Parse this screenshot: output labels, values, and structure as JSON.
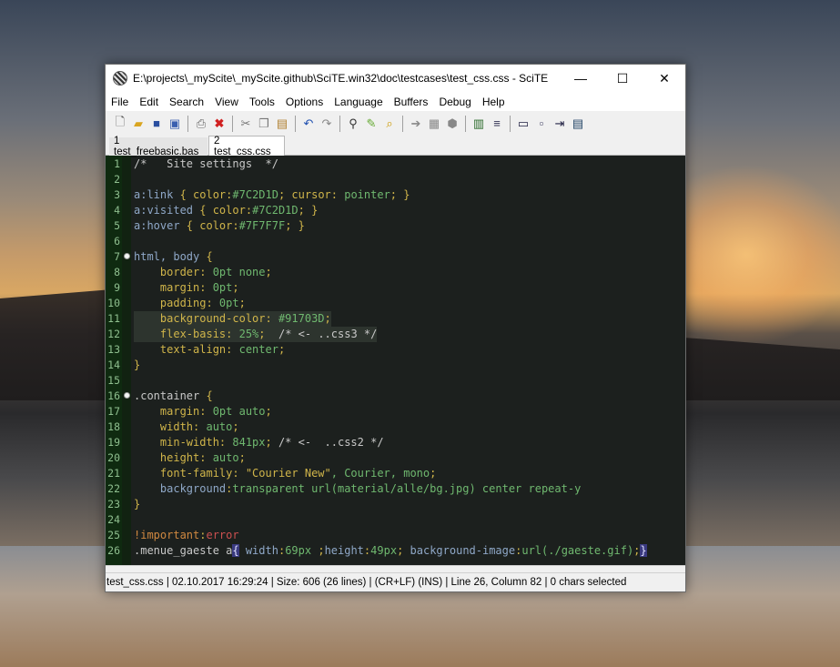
{
  "window": {
    "title": "E:\\projects\\_myScite\\_myScite.github\\SciTE.win32\\doc\\testcases\\test_css.css - SciTE",
    "minimize": "—",
    "maximize": "☐",
    "close": "✕"
  },
  "menu": [
    "File",
    "Edit",
    "Search",
    "View",
    "Tools",
    "Options",
    "Language",
    "Buffers",
    "Debug",
    "Help"
  ],
  "toolbar_icons": [
    "new-icon",
    "open-icon",
    "save-icon",
    "save-all-icon",
    "print-icon",
    "close-file-icon",
    "cut-icon",
    "copy-icon",
    "paste-icon",
    "undo-icon",
    "redo-icon",
    "find-icon",
    "replace-icon",
    "find-in-files-icon",
    "compile-icon",
    "build-icon",
    "go-icon",
    "abbrev-icon",
    "wrap-icon",
    "toggle-output-icon",
    "macro-icon",
    "fold-icon",
    "options-icon"
  ],
  "tabs": [
    {
      "label": "1 test_freebasic.bas"
    },
    {
      "label": "2 test_css.css"
    }
  ],
  "code_lines": [
    {
      "n": "1",
      "segments": [
        [
          "c-com",
          "/*   Site settings  */"
        ]
      ]
    },
    {
      "n": "2",
      "segments": []
    },
    {
      "n": "3",
      "segments": [
        [
          "c-sel",
          "a:link "
        ],
        [
          "c-brace",
          "{ "
        ],
        [
          "c-prop",
          "color:"
        ],
        [
          "c-hashval",
          "#7C2D1D"
        ],
        [
          "c-brace",
          "; "
        ],
        [
          "c-prop",
          "cursor: "
        ],
        [
          "c-val",
          "pointer"
        ],
        [
          "c-brace",
          "; }"
        ]
      ]
    },
    {
      "n": "4",
      "segments": [
        [
          "c-sel",
          "a:visited "
        ],
        [
          "c-brace",
          "{ "
        ],
        [
          "c-prop",
          "color:"
        ],
        [
          "c-hashval",
          "#7C2D1D"
        ],
        [
          "c-brace",
          "; }"
        ]
      ]
    },
    {
      "n": "5",
      "segments": [
        [
          "c-sel",
          "a:hover "
        ],
        [
          "c-brace",
          "{ "
        ],
        [
          "c-prop",
          "color:"
        ],
        [
          "c-hashval",
          "#7F7F7F"
        ],
        [
          "c-brace",
          "; }"
        ]
      ]
    },
    {
      "n": "6",
      "segments": []
    },
    {
      "n": "7",
      "fold": true,
      "segments": [
        [
          "c-sel",
          "html, body "
        ],
        [
          "c-brace",
          "{"
        ]
      ]
    },
    {
      "n": "8",
      "segments": [
        [
          "c-prop",
          "    border: "
        ],
        [
          "c-val",
          "0pt none"
        ],
        [
          "c-brace",
          ";"
        ]
      ]
    },
    {
      "n": "9",
      "segments": [
        [
          "c-prop",
          "    margin: "
        ],
        [
          "c-val",
          "0pt"
        ],
        [
          "c-brace",
          ";"
        ]
      ]
    },
    {
      "n": "10",
      "segments": [
        [
          "c-prop",
          "    padding: "
        ],
        [
          "c-val",
          "0pt"
        ],
        [
          "c-brace",
          ";"
        ]
      ]
    },
    {
      "n": "11",
      "hl": true,
      "segments": [
        [
          "c-prop",
          "    background-color: "
        ],
        [
          "c-val",
          "#91703D"
        ],
        [
          "c-brace",
          ";"
        ]
      ]
    },
    {
      "n": "12",
      "hl": true,
      "segments": [
        [
          "c-prop",
          "    flex-basis: "
        ],
        [
          "c-val",
          "25%"
        ],
        [
          "c-brace",
          ";  "
        ],
        [
          "c-com",
          "/* <- ..css3 */"
        ]
      ]
    },
    {
      "n": "13",
      "segments": [
        [
          "c-prop",
          "    text-align: "
        ],
        [
          "c-val",
          "center"
        ],
        [
          "c-brace",
          ";"
        ]
      ]
    },
    {
      "n": "14",
      "segments": [
        [
          "c-brace",
          "}"
        ]
      ]
    },
    {
      "n": "15",
      "segments": []
    },
    {
      "n": "16",
      "fold": true,
      "segments": [
        [
          "c-cls",
          ".container "
        ],
        [
          "c-brace",
          "{"
        ]
      ]
    },
    {
      "n": "17",
      "segments": [
        [
          "c-prop",
          "    margin: "
        ],
        [
          "c-val",
          "0pt auto"
        ],
        [
          "c-brace",
          ";"
        ]
      ]
    },
    {
      "n": "18",
      "segments": [
        [
          "c-prop",
          "    width: "
        ],
        [
          "c-val",
          "auto"
        ],
        [
          "c-brace",
          ";"
        ]
      ]
    },
    {
      "n": "19",
      "segments": [
        [
          "c-prop",
          "    min-width: "
        ],
        [
          "c-val",
          "841px"
        ],
        [
          "c-brace",
          "; "
        ],
        [
          "c-com",
          "/* <-  ..css2 */"
        ]
      ]
    },
    {
      "n": "20",
      "segments": [
        [
          "c-prop",
          "    height: "
        ],
        [
          "c-val",
          "auto"
        ],
        [
          "c-brace",
          ";"
        ]
      ]
    },
    {
      "n": "21",
      "segments": [
        [
          "c-prop",
          "    font-family: "
        ],
        [
          "c-str",
          "\"Courier New\""
        ],
        [
          "c-val",
          ", Courier, mono"
        ],
        [
          "c-brace",
          ";"
        ]
      ]
    },
    {
      "n": "22",
      "segments": [
        [
          "c-sel",
          "    background"
        ],
        [
          "c-brace",
          ":"
        ],
        [
          "c-val",
          "transparent url(material/alle/bg.jpg) center repeat-y"
        ]
      ]
    },
    {
      "n": "23",
      "segments": [
        [
          "c-brace",
          "}"
        ]
      ]
    },
    {
      "n": "24",
      "segments": []
    },
    {
      "n": "25",
      "segments": [
        [
          "c-imp",
          "!important"
        ],
        [
          "c-brace",
          ":"
        ],
        [
          "c-err",
          "error"
        ]
      ]
    },
    {
      "n": "26",
      "segments": [
        [
          "c-cls",
          ".menue_gaeste a"
        ],
        [
          "bracehl",
          "{"
        ],
        [
          "c-sel",
          " width"
        ],
        [
          "c-brace",
          ":"
        ],
        [
          "c-val",
          "69px"
        ],
        [
          "c-brace",
          " ;"
        ],
        [
          "c-sel",
          "height"
        ],
        [
          "c-brace",
          ":"
        ],
        [
          "c-val",
          "49px"
        ],
        [
          "c-brace",
          "; "
        ],
        [
          "c-sel",
          "background-image"
        ],
        [
          "c-brace",
          ":"
        ],
        [
          "c-val",
          "url(./gaeste.gif)"
        ],
        [
          "c-brace",
          ";"
        ],
        [
          "bracehl",
          "}"
        ]
      ]
    }
  ],
  "status": {
    "text": "test_css.css | 02.10.2017 16:29:24  |  Size: 606 (26 lines)  |  (CR+LF)  (INS) |  Line 26, Column 82  |  0 chars selected"
  }
}
